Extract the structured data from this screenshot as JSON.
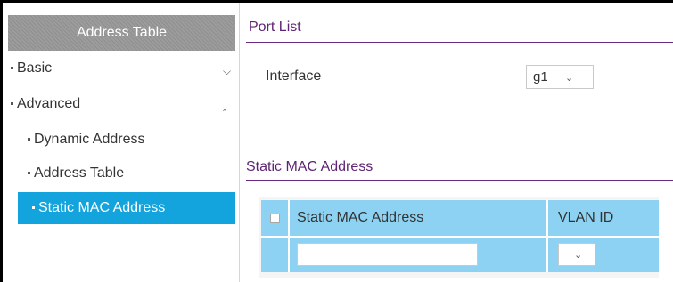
{
  "sidebar": {
    "header": "Address Table",
    "items": [
      {
        "label": "Basic",
        "icon": "chevron-down-icon"
      },
      {
        "label": "Advanced",
        "icon": "chevron-up-icon"
      }
    ],
    "sub_items": [
      {
        "label": "Dynamic Address"
      },
      {
        "label": "Address Table"
      },
      {
        "label": "Static MAC Address",
        "active": true
      }
    ]
  },
  "port_list": {
    "title": "Port List",
    "interface_label": "Interface",
    "interface_value": "g1"
  },
  "static_mac": {
    "title": "Static MAC Address",
    "columns": [
      "Static MAC Address",
      "VLAN ID"
    ],
    "input_value": "",
    "vlan_value": ""
  },
  "colors": {
    "accent_purple": "#6a2a7f",
    "active_blue": "#13a4de",
    "table_blue": "#8dd2f2"
  }
}
